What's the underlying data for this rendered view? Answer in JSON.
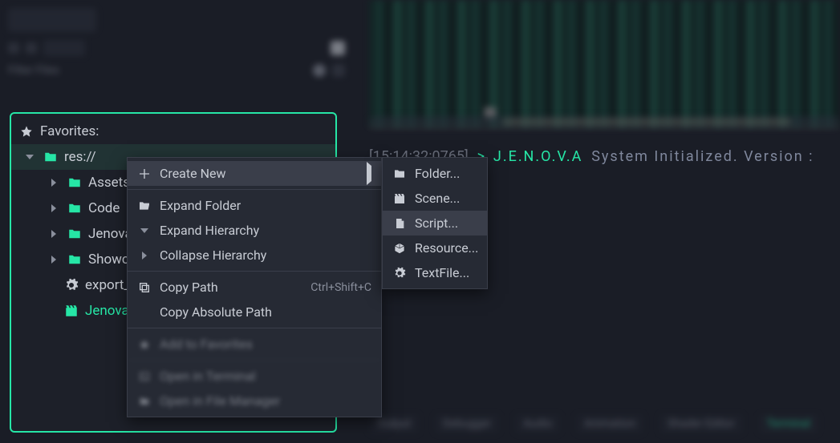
{
  "top": {
    "filter_label": "Filter Files"
  },
  "terminal": {
    "timestamp": "[15:14:32:0765]",
    "prompt": ">",
    "system": "J.E.N.O.V.A",
    "message": "System Initialized. Version :"
  },
  "filetree": {
    "favorites": "Favorites:",
    "root": "res://",
    "items": [
      "Assets",
      "Code",
      "Jenova",
      "Showcase",
      "export_pr",
      "Jenova-La"
    ]
  },
  "context_menu": {
    "create_new": "Create New",
    "expand_folder": "Expand Folder",
    "expand_hierarchy": "Expand Hierarchy",
    "collapse_hierarchy": "Collapse Hierarchy",
    "copy_path": "Copy Path",
    "copy_path_shortcut": "Ctrl+Shift+C",
    "copy_absolute_path": "Copy Absolute Path",
    "add_to_favorites": "Add to Favorites",
    "open_terminal": "Open in Terminal",
    "open_file_manager": "Open in File Manager"
  },
  "create_submenu": {
    "folder": "Folder...",
    "scene": "Scene...",
    "script": "Script...",
    "resource": "Resource...",
    "textfile": "TextFile..."
  },
  "bottom_tabs": [
    "Output",
    "Debugger",
    "Audio",
    "Animation",
    "Shader Editor",
    "Terminal"
  ]
}
